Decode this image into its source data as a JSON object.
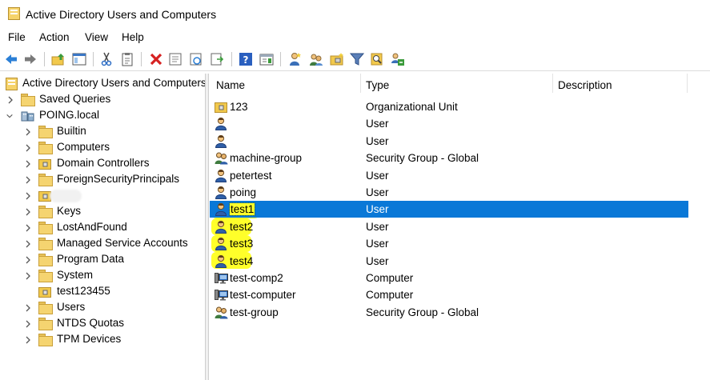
{
  "window": {
    "title": "Active Directory Users and Computers"
  },
  "menu": [
    "File",
    "Action",
    "View",
    "Help"
  ],
  "toolbar": {
    "icons": [
      "back-arrow-icon",
      "forward-arrow-icon",
      "up-folder-icon",
      "show-hide-tree-icon",
      "cut-icon",
      "copy-icon",
      "delete-icon",
      "properties-icon",
      "refresh-icon",
      "export-list-icon",
      "help-icon",
      "details-view-icon",
      "new-user-icon",
      "new-group-icon",
      "new-ou-icon",
      "filter-icon",
      "find-icon",
      "delegate-control-icon"
    ]
  },
  "tree": {
    "root": "Active Directory Users and Computers",
    "saved_queries": "Saved Queries",
    "domain": "POING.local",
    "children": [
      {
        "label": "Builtin"
      },
      {
        "label": "Computers"
      },
      {
        "label": "Domain Controllers"
      },
      {
        "label": "ForeignSecurityPrincipals"
      },
      {
        "label": ""
      },
      {
        "label": "Keys"
      },
      {
        "label": "LostAndFound"
      },
      {
        "label": "Managed Service Accounts"
      },
      {
        "label": "Program Data"
      },
      {
        "label": "System"
      },
      {
        "label": "test123455"
      },
      {
        "label": "Users"
      },
      {
        "label": "NTDS Quotas"
      },
      {
        "label": "TPM Devices"
      }
    ]
  },
  "list": {
    "columns": [
      "Name",
      "Type",
      "Description"
    ],
    "rows": [
      {
        "name": "123",
        "type": "Organizational Unit",
        "icon": "ou-icon"
      },
      {
        "name": "",
        "type": "User",
        "icon": "user-icon"
      },
      {
        "name": "",
        "type": "User",
        "icon": "user-icon"
      },
      {
        "name": "machine-group",
        "type": "Security Group - Global",
        "icon": "group-icon"
      },
      {
        "name": "petertest",
        "type": "User",
        "icon": "user-icon"
      },
      {
        "name": "poing",
        "type": "User",
        "icon": "user-icon"
      },
      {
        "name": "test1",
        "type": "User",
        "icon": "user-icon"
      },
      {
        "name": "test2",
        "type": "User",
        "icon": "user-icon"
      },
      {
        "name": "test3",
        "type": "User",
        "icon": "user-icon"
      },
      {
        "name": "test4",
        "type": "User",
        "icon": "user-icon"
      },
      {
        "name": "test-comp2",
        "type": "Computer",
        "icon": "computer-icon"
      },
      {
        "name": "test-computer",
        "type": "Computer",
        "icon": "computer-icon"
      },
      {
        "name": "test-group",
        "type": "Security Group - Global",
        "icon": "group-icon"
      }
    ],
    "selected": "test1",
    "highlighted": [
      "test1",
      "test2",
      "test3",
      "test4"
    ],
    "highlight_color": "#ffff2a",
    "selection_color": "#0a78d7"
  }
}
